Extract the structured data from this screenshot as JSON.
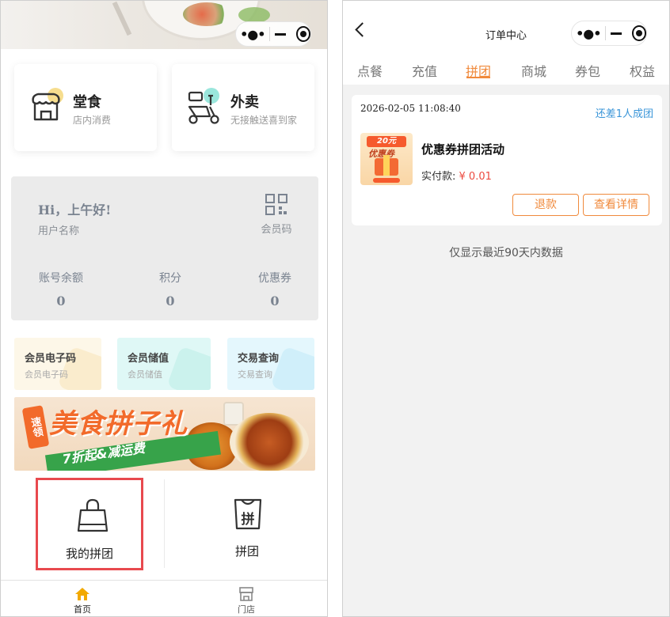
{
  "left": {
    "services": [
      {
        "title": "堂食",
        "subtitle": "店内消费"
      },
      {
        "title": "外卖",
        "subtitle": "无接触送喜到家"
      }
    ],
    "member": {
      "greeting": "Hi，上午好!",
      "username": "用户名称",
      "qr_label": "会员码",
      "stats": [
        {
          "label": "账号余额",
          "value": "0"
        },
        {
          "label": "积分",
          "value": "0"
        },
        {
          "label": "优惠券",
          "value": "0"
        }
      ]
    },
    "shortcuts": [
      {
        "title": "会员电子码",
        "subtitle": "会员电子码",
        "bg": "#fdf7e8",
        "deco": "#f7e3b6"
      },
      {
        "title": "会员储值",
        "subtitle": "会员储值",
        "bg": "#dff8f6",
        "deco": "#b9ece6"
      },
      {
        "title": "交易查询",
        "subtitle": "交易查询",
        "bg": "#e4f7fd",
        "deco": "#bfe9f7"
      }
    ],
    "banner": {
      "headline": "美食拼子礼",
      "tag": "速领",
      "subline": "7折起&减运费"
    },
    "group": [
      {
        "label": "我的拼团"
      },
      {
        "label": "拼团"
      }
    ],
    "tabbar": [
      {
        "label": "首页",
        "active": true
      },
      {
        "label": "门店",
        "active": false
      }
    ]
  },
  "right": {
    "title": "订单中心",
    "tabs": [
      "点餐",
      "充值",
      "拼团",
      "商城",
      "券包",
      "权益"
    ],
    "active_tab": "拼团",
    "order": {
      "time": "2026-02-05 11:08:40",
      "status": "还差1人成团",
      "name": "优惠券拼团活动",
      "pay_label": "实付款: ",
      "price": "¥ 0.01",
      "thumb_top": "20元",
      "thumb_mid": "优惠券",
      "buttons": [
        "退款",
        "查看详情"
      ]
    },
    "footnote": "仅显示最近90天内数据"
  },
  "colors": {
    "accent": "#f08a3c",
    "link": "#3a95d8",
    "price": "#ec4a3f",
    "highlight": "#e8494e",
    "tab_active": "#f2a900"
  }
}
